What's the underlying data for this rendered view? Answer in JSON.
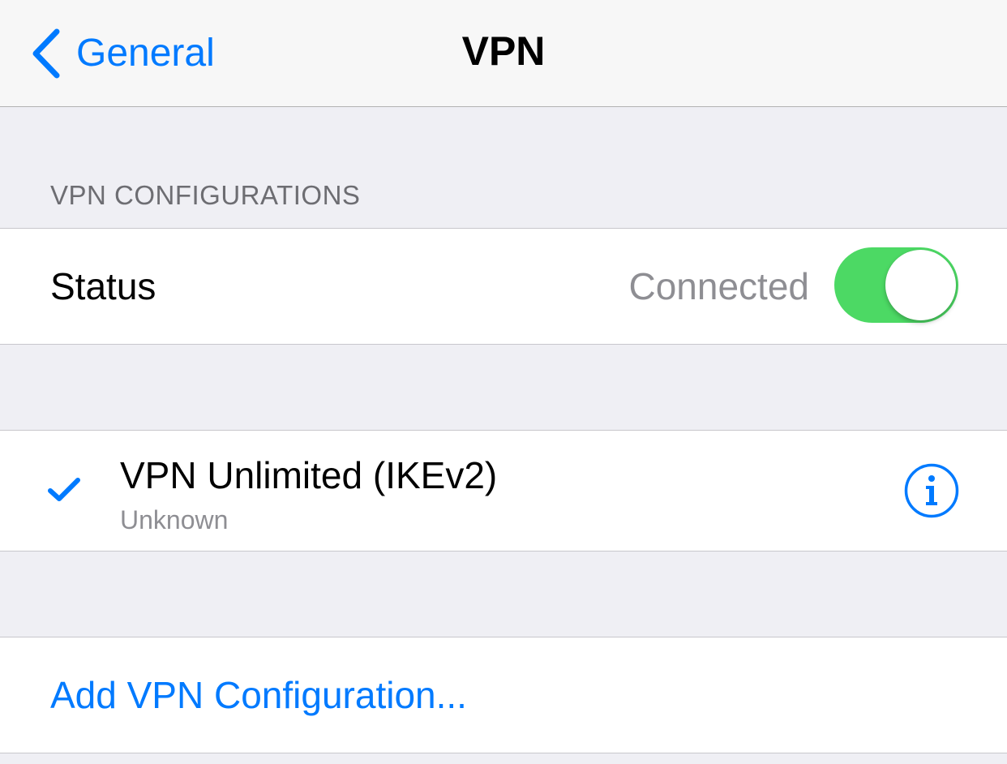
{
  "navbar": {
    "back_label": "General",
    "title": "VPN"
  },
  "section": {
    "header": "VPN CONFIGURATIONS"
  },
  "status_row": {
    "label": "Status",
    "value": "Connected",
    "toggle_on": true
  },
  "configurations": [
    {
      "name": "VPN Unlimited (IKEv2)",
      "subtitle": "Unknown",
      "selected": true
    }
  ],
  "add_row": {
    "label": "Add VPN Configuration..."
  },
  "icons": {
    "back": "chevron-left-icon",
    "selected": "checkmark-icon",
    "info": "info-circle-icon"
  },
  "colors": {
    "accent": "#007aff",
    "toggle_on": "#4cd964",
    "background": "#efeff4",
    "secondary_text": "#8e8e93"
  }
}
